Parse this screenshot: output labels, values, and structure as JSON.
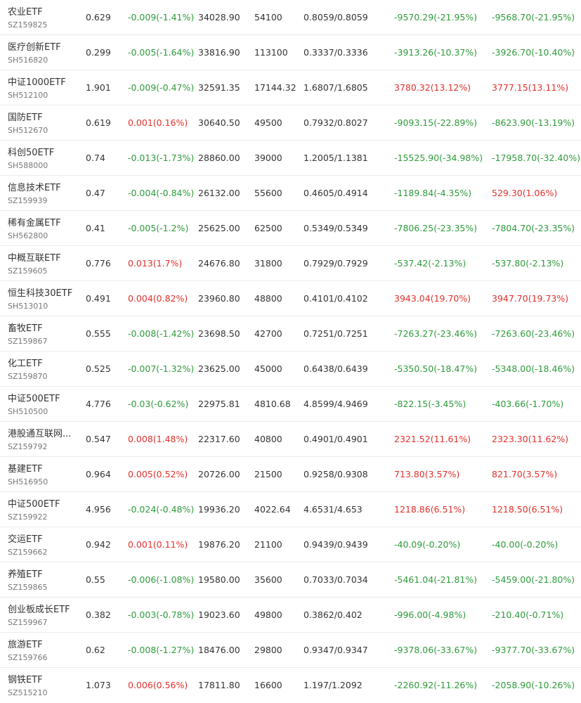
{
  "colors": {
    "up": "#e3302c",
    "down": "#2e9a3c",
    "text": "#333333",
    "code": "#777777"
  },
  "rows": [
    {
      "name": "农业ETF",
      "code": "SZ159825",
      "price": "0.629",
      "change": "-0.009(-1.41%)",
      "change_dir": "down",
      "amount": "34028.90",
      "volume": "54100",
      "cost": "0.8059/0.8059",
      "pnl1": "-9570.29(-21.95%)",
      "pnl1_dir": "down",
      "pnl2": "-9568.70(-21.95%)",
      "pnl2_dir": "down"
    },
    {
      "name": "医疗创新ETF",
      "code": "SH516820",
      "price": "0.299",
      "change": "-0.005(-1.64%)",
      "change_dir": "down",
      "amount": "33816.90",
      "volume": "113100",
      "cost": "0.3337/0.3336",
      "pnl1": "-3913.26(-10.37%)",
      "pnl1_dir": "down",
      "pnl2": "-3926.70(-10.40%)",
      "pnl2_dir": "down"
    },
    {
      "name": "中证1000ETF",
      "code": "SH512100",
      "price": "1.901",
      "change": "-0.009(-0.47%)",
      "change_dir": "down",
      "amount": "32591.35",
      "volume": "17144.32",
      "cost": "1.6807/1.6805",
      "pnl1": "3780.32(13.12%)",
      "pnl1_dir": "up",
      "pnl2": "3777.15(13.11%)",
      "pnl2_dir": "up"
    },
    {
      "name": "国防ETF",
      "code": "SH512670",
      "price": "0.619",
      "change": "0.001(0.16%)",
      "change_dir": "up",
      "amount": "30640.50",
      "volume": "49500",
      "cost": "0.7932/0.8027",
      "pnl1": "-9093.15(-22.89%)",
      "pnl1_dir": "down",
      "pnl2": "-8623.90(-13.19%)",
      "pnl2_dir": "down"
    },
    {
      "name": "科创50ETF",
      "code": "SH588000",
      "price": "0.74",
      "change": "-0.013(-1.73%)",
      "change_dir": "down",
      "amount": "28860.00",
      "volume": "39000",
      "cost": "1.2005/1.1381",
      "pnl1": "-15525.90(-34.98%)",
      "pnl1_dir": "down",
      "pnl2": "-17958.70(-32.40%)",
      "pnl2_dir": "down"
    },
    {
      "name": "信息技术ETF",
      "code": "SZ159939",
      "price": "0.47",
      "change": "-0.004(-0.84%)",
      "change_dir": "down",
      "amount": "26132.00",
      "volume": "55600",
      "cost": "0.4605/0.4914",
      "pnl1": "-1189.84(-4.35%)",
      "pnl1_dir": "down",
      "pnl2": "529.30(1.06%)",
      "pnl2_dir": "up"
    },
    {
      "name": "稀有金属ETF",
      "code": "SH562800",
      "price": "0.41",
      "change": "-0.005(-1.2%)",
      "change_dir": "down",
      "amount": "25625.00",
      "volume": "62500",
      "cost": "0.5349/0.5349",
      "pnl1": "-7806.25(-23.35%)",
      "pnl1_dir": "down",
      "pnl2": "-7804.70(-23.35%)",
      "pnl2_dir": "down"
    },
    {
      "name": "中概互联ETF",
      "code": "SZ159605",
      "price": "0.776",
      "change": "0.013(1.7%)",
      "change_dir": "up",
      "amount": "24676.80",
      "volume": "31800",
      "cost": "0.7929/0.7929",
      "pnl1": "-537.42(-2.13%)",
      "pnl1_dir": "down",
      "pnl2": "-537.80(-2.13%)",
      "pnl2_dir": "down"
    },
    {
      "name": "恒生科技30ETF",
      "code": "SH513010",
      "price": "0.491",
      "change": "0.004(0.82%)",
      "change_dir": "up",
      "amount": "23960.80",
      "volume": "48800",
      "cost": "0.4101/0.4102",
      "pnl1": "3943.04(19.70%)",
      "pnl1_dir": "up",
      "pnl2": "3947.70(19.73%)",
      "pnl2_dir": "up"
    },
    {
      "name": "畜牧ETF",
      "code": "SZ159867",
      "price": "0.555",
      "change": "-0.008(-1.42%)",
      "change_dir": "down",
      "amount": "23698.50",
      "volume": "42700",
      "cost": "0.7251/0.7251",
      "pnl1": "-7263.27(-23.46%)",
      "pnl1_dir": "down",
      "pnl2": "-7263.60(-23.46%)",
      "pnl2_dir": "down"
    },
    {
      "name": "化工ETF",
      "code": "SZ159870",
      "price": "0.525",
      "change": "-0.007(-1.32%)",
      "change_dir": "down",
      "amount": "23625.00",
      "volume": "45000",
      "cost": "0.6438/0.6439",
      "pnl1": "-5350.50(-18.47%)",
      "pnl1_dir": "down",
      "pnl2": "-5348.00(-18.46%)",
      "pnl2_dir": "down"
    },
    {
      "name": "中证500ETF",
      "code": "SH510500",
      "price": "4.776",
      "change": "-0.03(-0.62%)",
      "change_dir": "down",
      "amount": "22975.81",
      "volume": "4810.68",
      "cost": "4.8599/4.9469",
      "pnl1": "-822.15(-3.45%)",
      "pnl1_dir": "down",
      "pnl2": "-403.66(-1.70%)",
      "pnl2_dir": "down"
    },
    {
      "name": "港股通互联网...",
      "code": "SZ159792",
      "price": "0.547",
      "change": "0.008(1.48%)",
      "change_dir": "up",
      "amount": "22317.60",
      "volume": "40800",
      "cost": "0.4901/0.4901",
      "pnl1": "2321.52(11.61%)",
      "pnl1_dir": "up",
      "pnl2": "2323.30(11.62%)",
      "pnl2_dir": "up"
    },
    {
      "name": "基建ETF",
      "code": "SH516950",
      "price": "0.964",
      "change": "0.005(0.52%)",
      "change_dir": "up",
      "amount": "20726.00",
      "volume": "21500",
      "cost": "0.9258/0.9308",
      "pnl1": "713.80(3.57%)",
      "pnl1_dir": "up",
      "pnl2": "821.70(3.57%)",
      "pnl2_dir": "up"
    },
    {
      "name": "中证500ETF",
      "code": "SZ159922",
      "price": "4.956",
      "change": "-0.024(-0.48%)",
      "change_dir": "down",
      "amount": "19936.20",
      "volume": "4022.64",
      "cost": "4.6531/4.653",
      "pnl1": "1218.86(6.51%)",
      "pnl1_dir": "up",
      "pnl2": "1218.50(6.51%)",
      "pnl2_dir": "up"
    },
    {
      "name": "交运ETF",
      "code": "SZ159662",
      "price": "0.942",
      "change": "0.001(0.11%)",
      "change_dir": "up",
      "amount": "19876.20",
      "volume": "21100",
      "cost": "0.9439/0.9439",
      "pnl1": "-40.09(-0.20%)",
      "pnl1_dir": "down",
      "pnl2": "-40.00(-0.20%)",
      "pnl2_dir": "down"
    },
    {
      "name": "养殖ETF",
      "code": "SZ159865",
      "price": "0.55",
      "change": "-0.006(-1.08%)",
      "change_dir": "down",
      "amount": "19580.00",
      "volume": "35600",
      "cost": "0.7033/0.7034",
      "pnl1": "-5461.04(-21.81%)",
      "pnl1_dir": "down",
      "pnl2": "-5459.00(-21.80%)",
      "pnl2_dir": "down"
    },
    {
      "name": "创业板成长ETF",
      "code": "SZ159967",
      "price": "0.382",
      "change": "-0.003(-0.78%)",
      "change_dir": "down",
      "amount": "19023.60",
      "volume": "49800",
      "cost": "0.3862/0.402",
      "pnl1": "-996.00(-4.98%)",
      "pnl1_dir": "down",
      "pnl2": "-210.40(-0.71%)",
      "pnl2_dir": "down"
    },
    {
      "name": "旅游ETF",
      "code": "SZ159766",
      "price": "0.62",
      "change": "-0.008(-1.27%)",
      "change_dir": "down",
      "amount": "18476.00",
      "volume": "29800",
      "cost": "0.9347/0.9347",
      "pnl1": "-9378.06(-33.67%)",
      "pnl1_dir": "down",
      "pnl2": "-9377.70(-33.67%)",
      "pnl2_dir": "down"
    },
    {
      "name": "钢铁ETF",
      "code": "SZ515210",
      "price": "1.073",
      "change": "0.006(0.56%)",
      "change_dir": "up",
      "amount": "17811.80",
      "volume": "16600",
      "cost": "1.197/1.2092",
      "pnl1": "-2260.92(-11.26%)",
      "pnl1_dir": "down",
      "pnl2": "-2058.90(-10.26%)",
      "pnl2_dir": "down"
    }
  ]
}
